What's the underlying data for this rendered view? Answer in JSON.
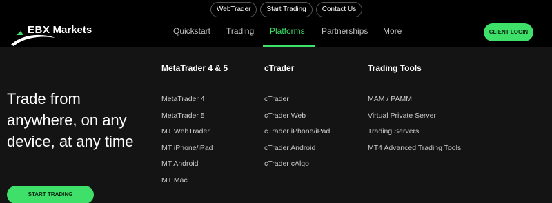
{
  "top_links": [
    "WebTrader",
    "Start Trading",
    "Contact Us"
  ],
  "logo": {
    "text_ebx": "EBX",
    "text_markets": "Markets"
  },
  "nav": {
    "items": [
      "Quickstart",
      "Trading",
      "Platforms",
      "Partnerships",
      "More"
    ],
    "active": "Platforms"
  },
  "client_login": "CLIENT LOGIN",
  "hero": {
    "headline": "Trade from anywhere, on any device, at any time",
    "cta": "START TRADING"
  },
  "menu": {
    "columns": [
      {
        "title": "MetaTrader 4 & 5",
        "items": [
          "MetaTrader 4",
          "MetaTrader 5",
          "MT WebTrader",
          "MT iPhone/iPad",
          "MT Android",
          "MT Mac"
        ]
      },
      {
        "title": "cTrader",
        "items": [
          "cTrader",
          "cTrader Web",
          "cTrader iPhone/iPad",
          "cTrader Android",
          "cTrader cAlgo"
        ]
      },
      {
        "title": "Trading Tools",
        "items": [
          "MAM / PAMM",
          "Virtual Private Server",
          "Trading Servers",
          "MT4 Advanced Trading Tools"
        ]
      }
    ]
  },
  "colors": {
    "accent": "#3ee06a",
    "background": "#141414",
    "header": "#000000"
  }
}
